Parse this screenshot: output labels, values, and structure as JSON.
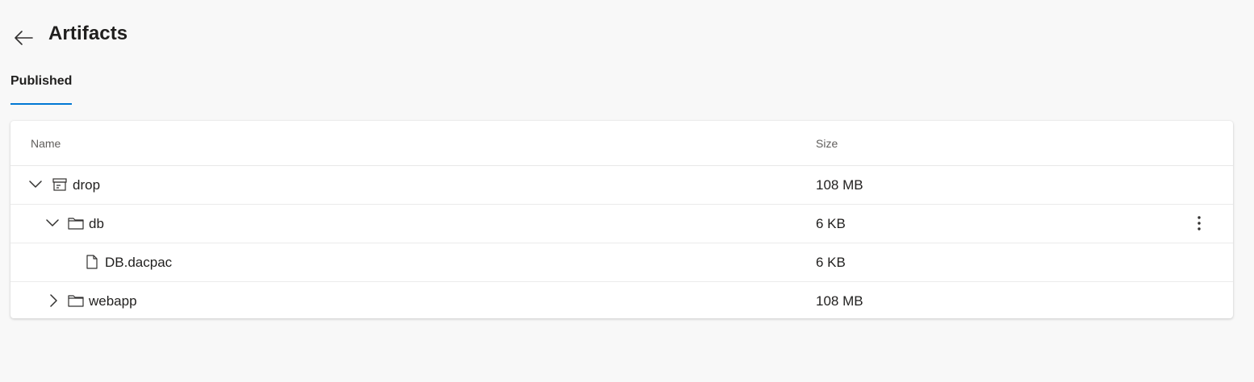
{
  "header": {
    "title": "Artifacts",
    "back_icon": "arrow-left-icon"
  },
  "tabs": [
    {
      "label": "Published",
      "selected": true
    }
  ],
  "accent_color": "#0078d4",
  "table": {
    "columns": {
      "name": "Name",
      "size": "Size"
    },
    "rows": [
      {
        "name": "drop",
        "size": "108 MB",
        "type": "artifact",
        "depth": 0,
        "expanded": true,
        "icon": "artifact-icon"
      },
      {
        "name": "db",
        "size": "6 KB",
        "type": "folder",
        "depth": 1,
        "expanded": true,
        "icon": "folder-icon",
        "has_menu": true
      },
      {
        "name": "DB.dacpac",
        "size": "6 KB",
        "type": "file",
        "depth": 2,
        "icon": "file-icon"
      },
      {
        "name": "webapp",
        "size": "108 MB",
        "type": "folder",
        "depth": 1,
        "expanded": false,
        "icon": "folder-icon"
      }
    ]
  }
}
